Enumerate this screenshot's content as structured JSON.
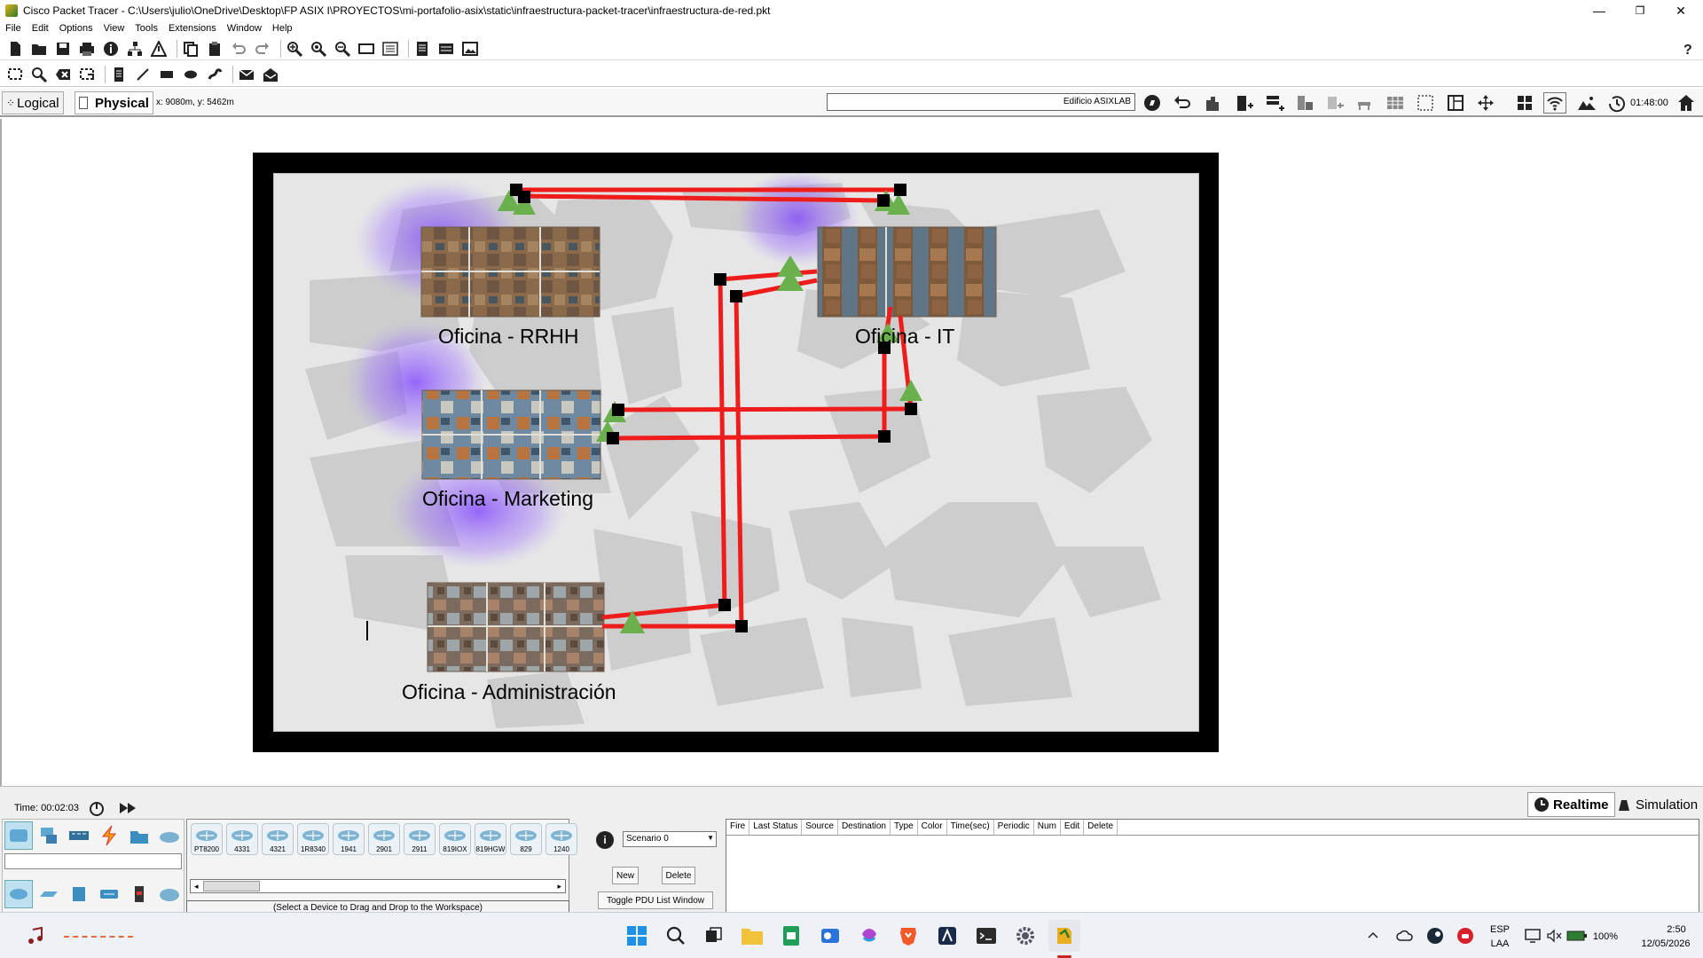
{
  "window": {
    "title": "Cisco Packet Tracer - C:\\Users\\julio\\OneDrive\\Desktop\\FP ASIX I\\PROYECTOS\\mi-portafolio-asix\\static\\infraestructura-packet-tracer\\infraestructura-de-red.pkt",
    "minimize": "—",
    "restore": "❐",
    "close": "✕"
  },
  "menu": {
    "file": "File",
    "edit": "Edit",
    "options": "Options",
    "view": "View",
    "tools": "Tools",
    "extensions": "Extensions",
    "window": "Window",
    "help": "Help"
  },
  "mode_bar": {
    "logical": "Logical",
    "physical": "Physical",
    "coords": "x: 9080m, y: 5462m",
    "location": "Edificio ASIXLAB",
    "clock": "01:48:00"
  },
  "map": {
    "offices": [
      {
        "name": "Oficina - RRHH"
      },
      {
        "name": "Oficina - IT"
      },
      {
        "name": "Oficina - Marketing"
      },
      {
        "name": "Oficina - Administración"
      }
    ],
    "link_color": "#ef1c1c",
    "device_color": "#6ab04c"
  },
  "simulation": {
    "time_label": "Time: 00:02:03",
    "realtime": "Realtime",
    "simulation": "Simulation",
    "scenario": "Scenario 0",
    "new": "New",
    "delete": "Delete",
    "toggle_pdu": "Toggle PDU List Window",
    "hint": "(Select a Device to Drag and Drop to the Workspace)",
    "pdu_columns": [
      "Fire",
      "Last Status",
      "Source",
      "Destination",
      "Type",
      "Color",
      "Time(sec)",
      "Periodic",
      "Num",
      "Edit",
      "Delete"
    ]
  },
  "devices": [
    "PT8200",
    "4331",
    "4321",
    "1R8340",
    "1941",
    "2901",
    "2911",
    "819IOX",
    "819HGW",
    "829",
    "1240"
  ],
  "taskbar": {
    "lang_top": "ESP",
    "lang_bottom": "LAA",
    "battery": "100%",
    "time": "2:50",
    "date": "12/05/2026"
  }
}
